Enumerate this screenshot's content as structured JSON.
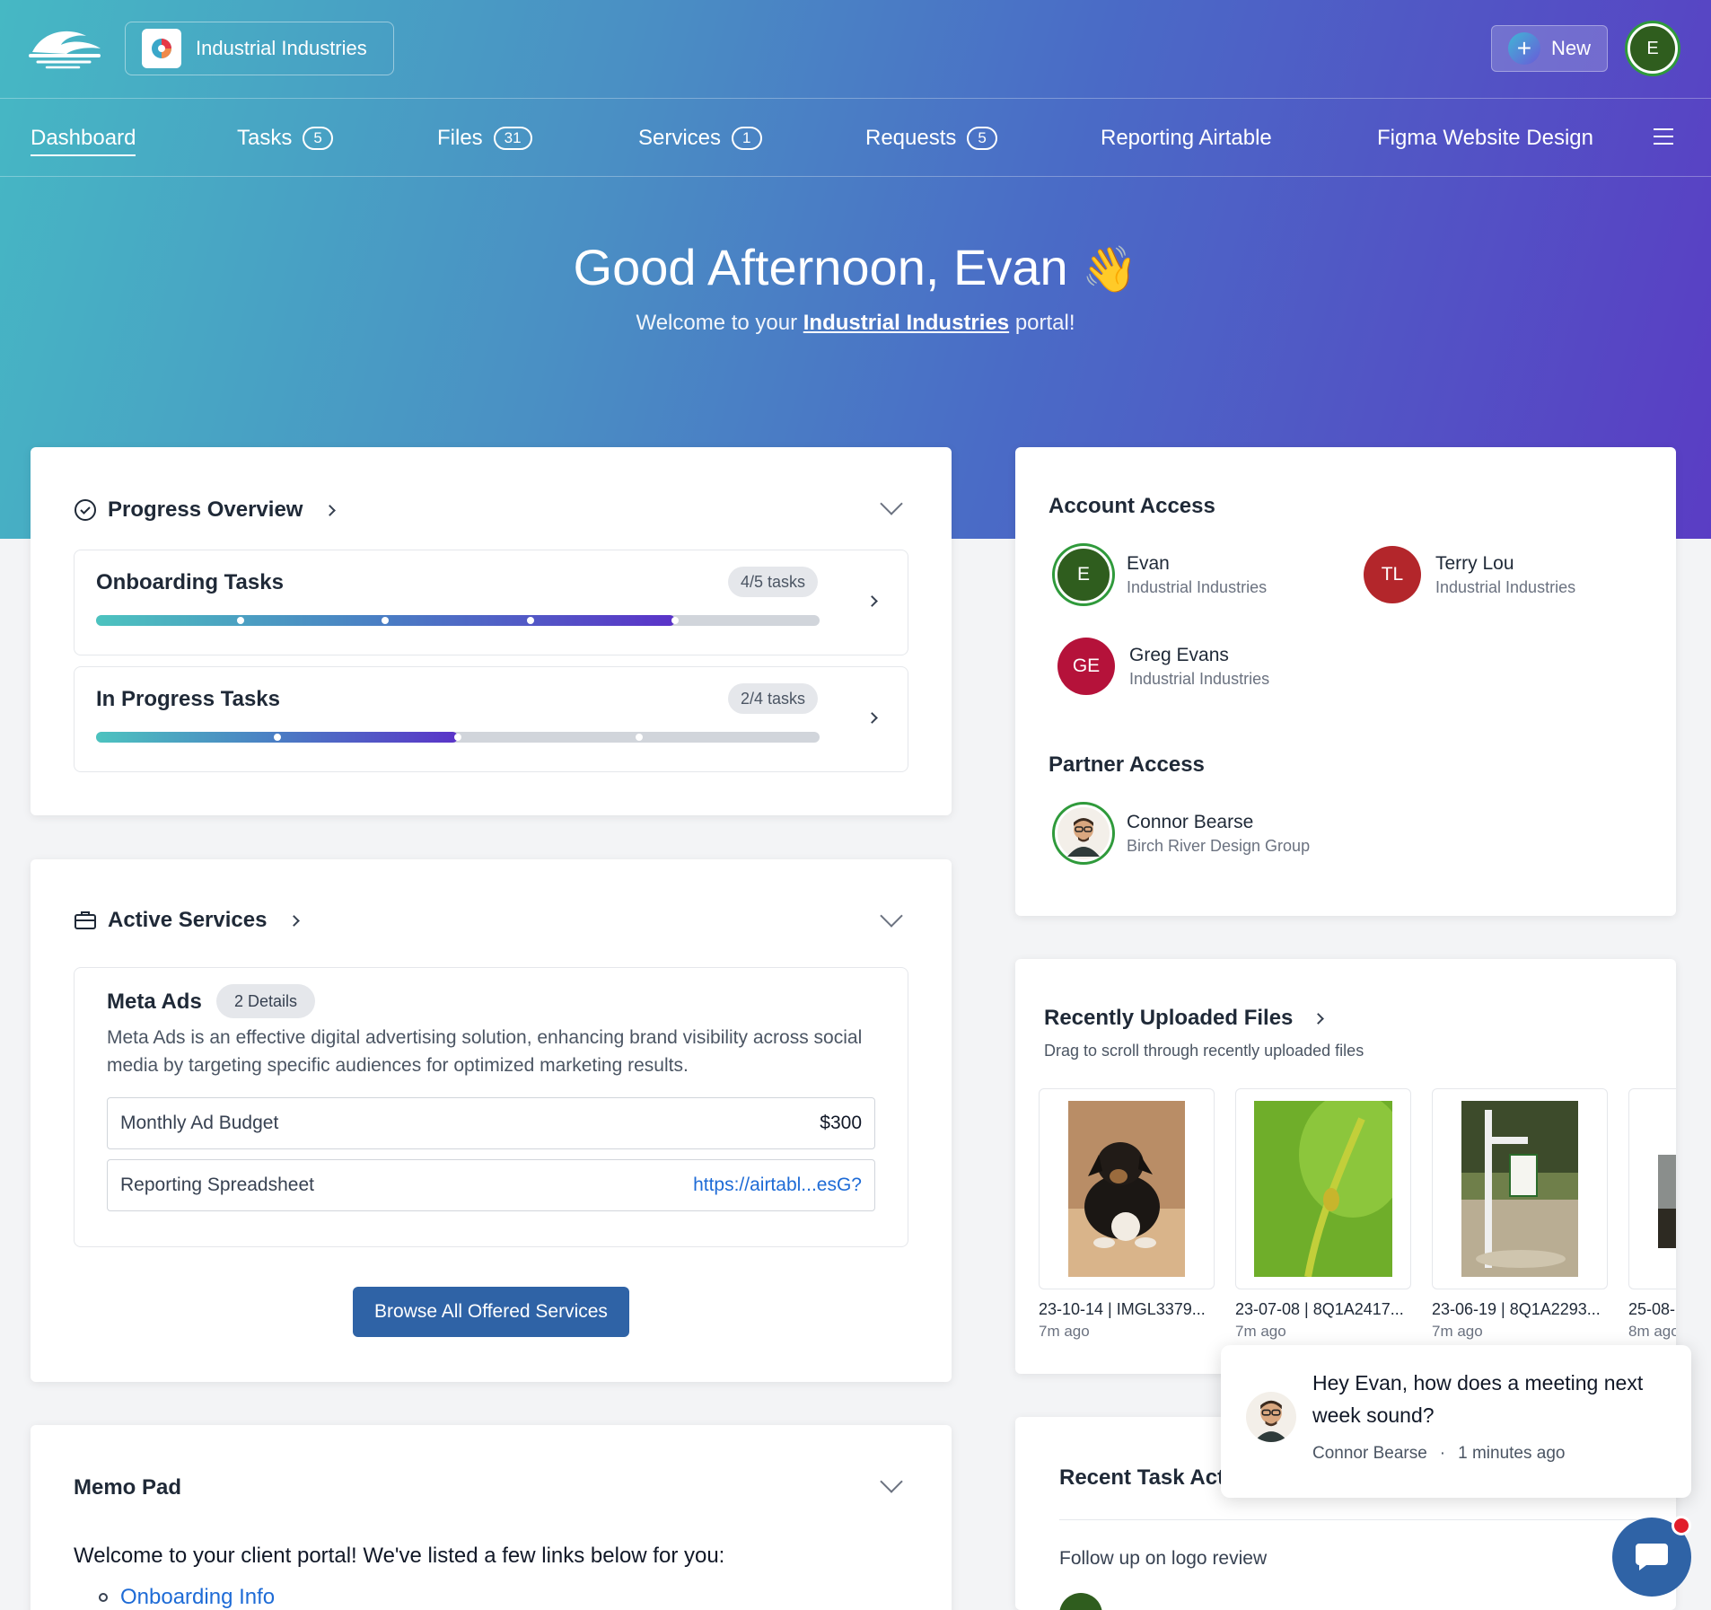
{
  "brand": {
    "org_name": "Industrial Industries"
  },
  "header": {
    "new_label": "New",
    "user_initial": "E"
  },
  "nav": {
    "items": [
      {
        "label": "Dashboard",
        "badge": ""
      },
      {
        "label": "Tasks",
        "badge": "5"
      },
      {
        "label": "Files",
        "badge": "31"
      },
      {
        "label": "Services",
        "badge": "1"
      },
      {
        "label": "Requests",
        "badge": "5"
      },
      {
        "label": "Reporting Airtable",
        "badge": ""
      },
      {
        "label": "Figma Website Design",
        "badge": ""
      }
    ]
  },
  "hero": {
    "greeting": "Good Afternoon, Evan",
    "wave": "👋",
    "welcome_pre": "Welcome to your",
    "welcome_link": "Industrial Industries",
    "welcome_post": "portal!"
  },
  "progress": {
    "title": "Progress Overview",
    "tasks": [
      {
        "name": "Onboarding Tasks",
        "count": "4/5 tasks",
        "done": 4,
        "total": 5
      },
      {
        "name": "In Progress Tasks",
        "count": "2/4 tasks",
        "done": 2,
        "total": 4
      }
    ]
  },
  "services": {
    "title": "Active Services",
    "service_name": "Meta Ads",
    "details_pill": "2 Details",
    "description": "Meta Ads is an effective digital advertising solution, enhancing brand visibility across social media by targeting specific audiences for optimized marketing results.",
    "rows": [
      {
        "label": "Monthly Ad Budget",
        "value": "$300"
      },
      {
        "label": "Reporting Spreadsheet",
        "value": "https://airtabl...esG?"
      }
    ],
    "browse_label": "Browse All Offered Services"
  },
  "memo": {
    "title": "Memo Pad",
    "intro": "Welcome to your client portal! We've listed a few links below for you:",
    "link1": "Onboarding Info"
  },
  "account_access": {
    "title": "Account Access",
    "users": [
      {
        "initials": "E",
        "name": "Evan",
        "org": "Industrial Industries",
        "color": "#2f5d1e"
      },
      {
        "initials": "TL",
        "name": "Terry Lou",
        "org": "Industrial Industries",
        "color": "#b3262b"
      },
      {
        "initials": "GE",
        "name": "Greg Evans",
        "org": "Industrial Industries",
        "color": "#b5123a"
      }
    ],
    "partner_title": "Partner Access",
    "partner": {
      "name": "Connor Bearse",
      "org": "Birch River Design Group"
    }
  },
  "files": {
    "title": "Recently Uploaded Files",
    "subtitle": "Drag to scroll through recently uploaded files",
    "items": [
      {
        "name": "23-10-14 | IMGL3379...",
        "ago": "7m ago"
      },
      {
        "name": "23-07-08 | 8Q1A2417...",
        "ago": "7m ago"
      },
      {
        "name": "23-06-19 | 8Q1A2293...",
        "ago": "7m ago"
      },
      {
        "name": "25-08-",
        "ago": "8m ago"
      }
    ]
  },
  "activity": {
    "title": "Recent Task Activity",
    "item1": "Follow up on logo review"
  },
  "chat": {
    "message": "Hey Evan, how does a meeting next week sound?",
    "sender": "Connor Bearse",
    "time": "1 minutes ago"
  },
  "colors": {
    "accent": "#2f63a6",
    "online_ring": "#2f9a3b",
    "notification": "#e11d2a"
  }
}
